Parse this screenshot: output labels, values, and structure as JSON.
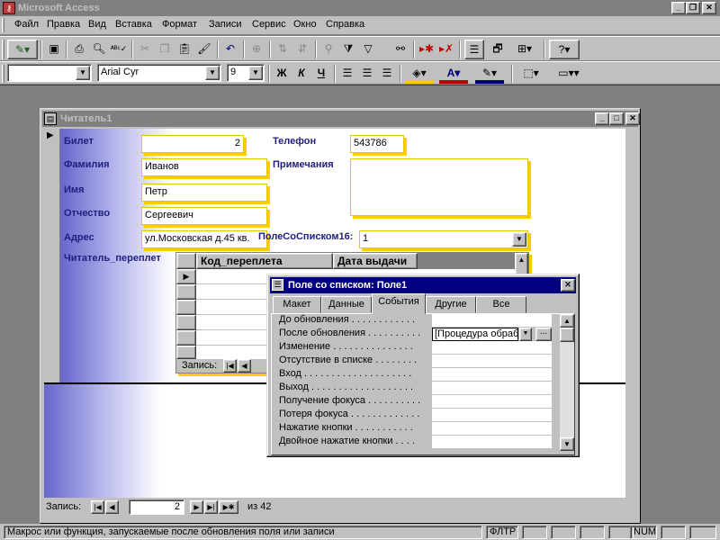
{
  "app": {
    "title": "Microsoft Access",
    "icon": "access-key-icon"
  },
  "window_controls": {
    "minimize": "_",
    "restore": "❐",
    "close": "✕"
  },
  "menu": [
    "Файл",
    "Правка",
    "Вид",
    "Вставка",
    "Формат",
    "Записи",
    "Сервис",
    "Окно",
    "Справка"
  ],
  "toolbar_format": {
    "object_combo": "",
    "font": "Arial Cyr",
    "size": "9",
    "bold": "Ж",
    "italic": "К",
    "underline": "Ч"
  },
  "form": {
    "title": "Читатель1",
    "labels": {
      "ticket": "Билет",
      "surname": "Фамилия",
      "name": "Имя",
      "patronymic": "Отчество",
      "address": "Адрес",
      "subform": "Читатель_переплет",
      "phone": "Телефон",
      "notes": "Примечания",
      "combo": "ПолеСоСписком16:"
    },
    "values": {
      "ticket": "2",
      "surname": "Иванов",
      "name": "Петр",
      "patronymic": "Сергеевич",
      "address": "ул.Московская д.45 кв.",
      "phone": "543786",
      "notes": "",
      "combo": "1"
    },
    "subform_grid": {
      "columns": [
        "Код_переплета",
        "Дата выдачи"
      ],
      "record_label": "Запись:"
    },
    "navigation": {
      "label": "Запись:",
      "current": "2",
      "of_label": "из 42"
    }
  },
  "property_sheet": {
    "title": "Поле со списком: Поле1",
    "tabs": [
      "Макет",
      "Данные",
      "События",
      "Другие",
      "Все"
    ],
    "active_tab": "События",
    "rows": [
      {
        "name": "До обновления . . . . . . . . . . . .",
        "value": ""
      },
      {
        "name": "После обновления . . . . . . . . . .",
        "value": "[Процедура обработки]"
      },
      {
        "name": "Изменение . . . . . . . . . . . . . . .",
        "value": ""
      },
      {
        "name": "Отсутствие в списке . . . . . . . .",
        "value": ""
      },
      {
        "name": "Вход . . . . . . . . . . . . . . . . . . . .",
        "value": ""
      },
      {
        "name": "Выход . . . . . . . . . . . . . . . . . . .",
        "value": ""
      },
      {
        "name": "Получение фокуса . . . . . . . . . .",
        "value": ""
      },
      {
        "name": "Потеря фокуса . . . . . . . . . . . . .",
        "value": ""
      },
      {
        "name": "Нажатие кнопки . . . . . . . . . . .",
        "value": ""
      },
      {
        "name": "Двойное нажатие кнопки . . . .",
        "value": ""
      }
    ],
    "builder_button": "..."
  },
  "statusbar": {
    "message": "Макрос или функция, запускаемые после обновления поля или записи",
    "filter": "ФЛТР",
    "num": "NUM"
  },
  "colors": {
    "label_text": "#202080",
    "field_shadow": "#ffcc00",
    "active_caption": "#000080",
    "inactive_caption": "#808080"
  }
}
